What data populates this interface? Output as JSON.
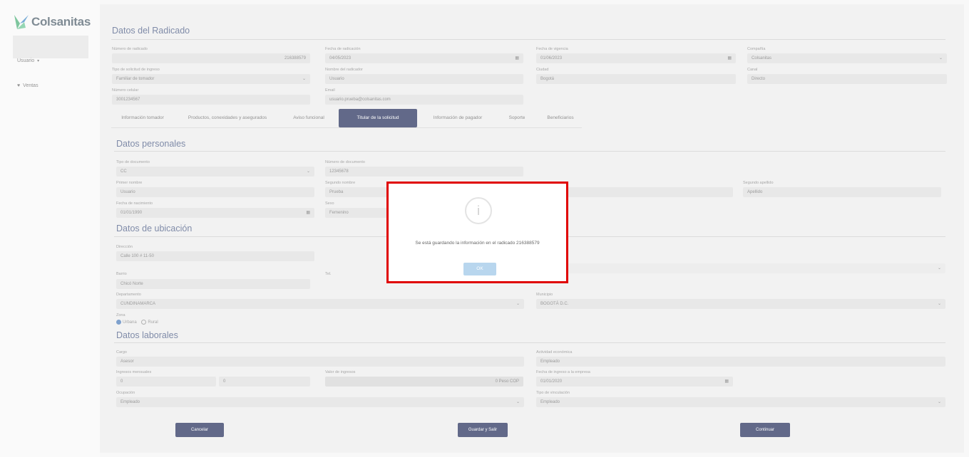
{
  "brand": {
    "name": "Colsanitas"
  },
  "sidebar": {
    "items": [
      {
        "label": "Usuario",
        "icon": "chevron-down-icon"
      },
      {
        "label": "Ventas",
        "icon": "heart-icon"
      }
    ]
  },
  "datos_radicado": {
    "title": "Datos del Radicado",
    "fields": {
      "numero_radicado": {
        "label": "Número de radicado",
        "value": "216388579"
      },
      "fecha_radicacion": {
        "label": "Fecha de radicación",
        "value": "04/05/2023"
      },
      "fecha_vigencia": {
        "label": "Fecha de vigencia",
        "value": "01/06/2023"
      },
      "compania": {
        "label": "Compañía",
        "value": "Colsanitas"
      },
      "tipo_solicitud": {
        "label": "Tipo de solicitud de ingreso",
        "value": "Familiar de tomador"
      },
      "nombre_radicador": {
        "label": "Nombre del radicador",
        "value": "Usuario"
      },
      "ciudad": {
        "label": "Ciudad",
        "value": "Bogotá"
      },
      "canal": {
        "label": "Canal",
        "value": "Directo"
      },
      "numero_celular": {
        "label": "Número celular",
        "value": "3001234567"
      },
      "email": {
        "label": "Email",
        "value": "usuario.prueba@colsanitas.com"
      }
    }
  },
  "tabs": [
    {
      "label": "Información tomador",
      "active": false
    },
    {
      "label": "Productos, conexidades y asegurados",
      "active": false
    },
    {
      "label": "Aviso funcional",
      "active": false
    },
    {
      "label": "Titular de la solicitud",
      "active": true
    },
    {
      "label": "Información de pagador",
      "active": false
    },
    {
      "label": "Soporte",
      "active": false
    },
    {
      "label": "Beneficiarios",
      "active": false
    }
  ],
  "datos_personales": {
    "title": "Datos personales",
    "fields": {
      "tipo_documento": {
        "label": "Tipo de documento",
        "value": "CC"
      },
      "numero_documento": {
        "label": "Número de documento",
        "value": "12345678"
      },
      "primer_nombre": {
        "label": "Primer nombre",
        "value": "Usuario"
      },
      "segundo_nombre": {
        "label": "Segundo nombre",
        "value": "Prueba"
      },
      "segundo_apellido": {
        "label": "Segundo apellido",
        "value": "Apellido"
      },
      "fecha_nacimiento": {
        "label": "Fecha de nacimiento",
        "value": "01/01/1990"
      },
      "sexo": {
        "label": "Sexo",
        "value": "Femenino"
      }
    }
  },
  "datos_ubicacion": {
    "title": "Datos de ubicación",
    "fields": {
      "direccion": {
        "label": "Dirección",
        "value": "Calle 100 # 11-50"
      },
      "barrio": {
        "label": "Barrio",
        "value": "Chicó Norte"
      },
      "telefono": {
        "label": "Tel.",
        "value": ""
      },
      "departamento": {
        "label": "Departamento",
        "value": "CUNDINAMARCA"
      },
      "municipio": {
        "label": "Municipio",
        "value": "BOGOTÁ D.C."
      },
      "zona": {
        "label": "Zona",
        "options": [
          "Urbana",
          "Rural"
        ],
        "selected": "Urbana"
      }
    }
  },
  "datos_laborales": {
    "title": "Datos laborales",
    "fields": {
      "cargo": {
        "label": "Cargo",
        "value": "Asesor"
      },
      "actividad_economica": {
        "label": "Actividad económica",
        "value": "Empleado"
      },
      "ingresos": {
        "label": "Ingresos mensuales",
        "value": "0",
        "secondary": "0"
      },
      "valor_ingresos": {
        "label": "Valor de ingresos",
        "value": "",
        "suffix": "0 Peso COP"
      },
      "fecha_ingreso": {
        "label": "Fecha de ingreso a la empresa",
        "value": "01/01/2020"
      },
      "ocupacion": {
        "label": "Ocupación",
        "value": "Empleado"
      },
      "tipo_vinculacion": {
        "label": "Tipo de vinculación",
        "value": "Empleado"
      }
    }
  },
  "buttons": {
    "cancel": "Cancelar",
    "save": "Guardar y Salir",
    "continue": "Continuar"
  },
  "dialog": {
    "icon": "info-icon",
    "message": "Se está guardando la información en el radicado 216388579",
    "ok_label": "OK"
  }
}
